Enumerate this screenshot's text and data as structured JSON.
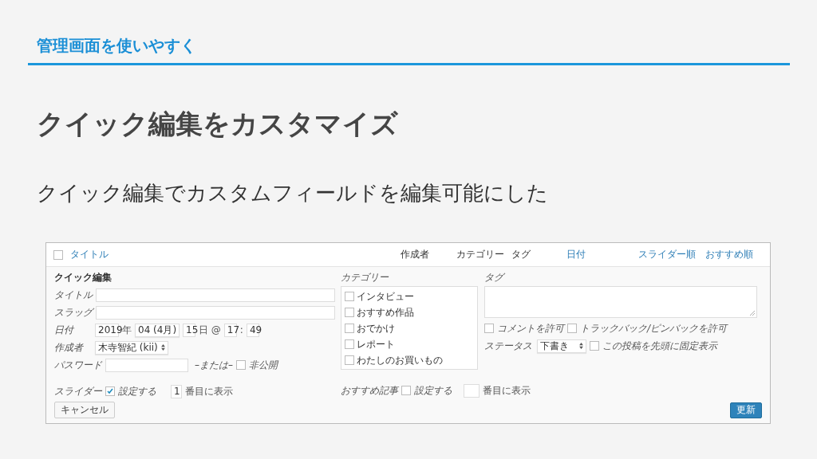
{
  "slide": {
    "section_title": "管理画面を使いやすく",
    "heading": "クイック編集をカスタマイズ",
    "subtitle": "クイック編集でカスタムフィールドを編集可能にした"
  },
  "list_header": {
    "select_all": {
      "checked": false
    },
    "columns": [
      {
        "label": "タイトル",
        "sortable": true
      },
      {
        "label": "作成者",
        "sortable": false
      },
      {
        "label": "カテゴリー",
        "sortable": false
      },
      {
        "label": "タグ",
        "sortable": false
      },
      {
        "label": "日付",
        "sortable": true
      },
      {
        "label": "スライダー順",
        "sortable": true
      },
      {
        "label": "おすすめ順",
        "sortable": true
      }
    ]
  },
  "quick_edit": {
    "title": "クイック編集",
    "title_label": "タイトル",
    "slug_label": "スラッグ",
    "date": {
      "label": "日付",
      "year": "2019",
      "year_unit": "年",
      "month": "04 (4月)",
      "day": "15",
      "day_unit": "日 @",
      "hour": "17",
      "separator": ":",
      "minute": "49"
    },
    "author": {
      "label": "作成者",
      "value": "木寺智紀 (kii)"
    },
    "password": {
      "label": "パスワード",
      "or": "–または–",
      "private": {
        "label": "非公開",
        "checked": false
      }
    },
    "slider": {
      "label": "スライダー",
      "enable": {
        "label": "設定する",
        "checked": true
      },
      "order": "1",
      "suffix": "番目に表示"
    },
    "categories": {
      "label": "カテゴリー",
      "items": [
        {
          "label": "インタビュー",
          "checked": false
        },
        {
          "label": "おすすめ作品",
          "checked": false
        },
        {
          "label": "おでかけ",
          "checked": false
        },
        {
          "label": "レポート",
          "checked": false
        },
        {
          "label": "わたしのお買いもの",
          "checked": false
        }
      ]
    },
    "featured": {
      "label": "おすすめ記事",
      "enable": {
        "label": "設定する",
        "checked": false
      },
      "suffix": "番目に表示"
    },
    "tags_label": "タグ",
    "comments": {
      "label": "コメントを許可",
      "checked": false
    },
    "pings": {
      "label": "トラックバック/ピンバックを許可",
      "checked": false
    },
    "status": {
      "label": "ステータス",
      "value": "下書き"
    },
    "sticky": {
      "label": "この投稿を先頭に固定表示",
      "checked": false
    },
    "cancel": "キャンセル",
    "update": "更新"
  }
}
